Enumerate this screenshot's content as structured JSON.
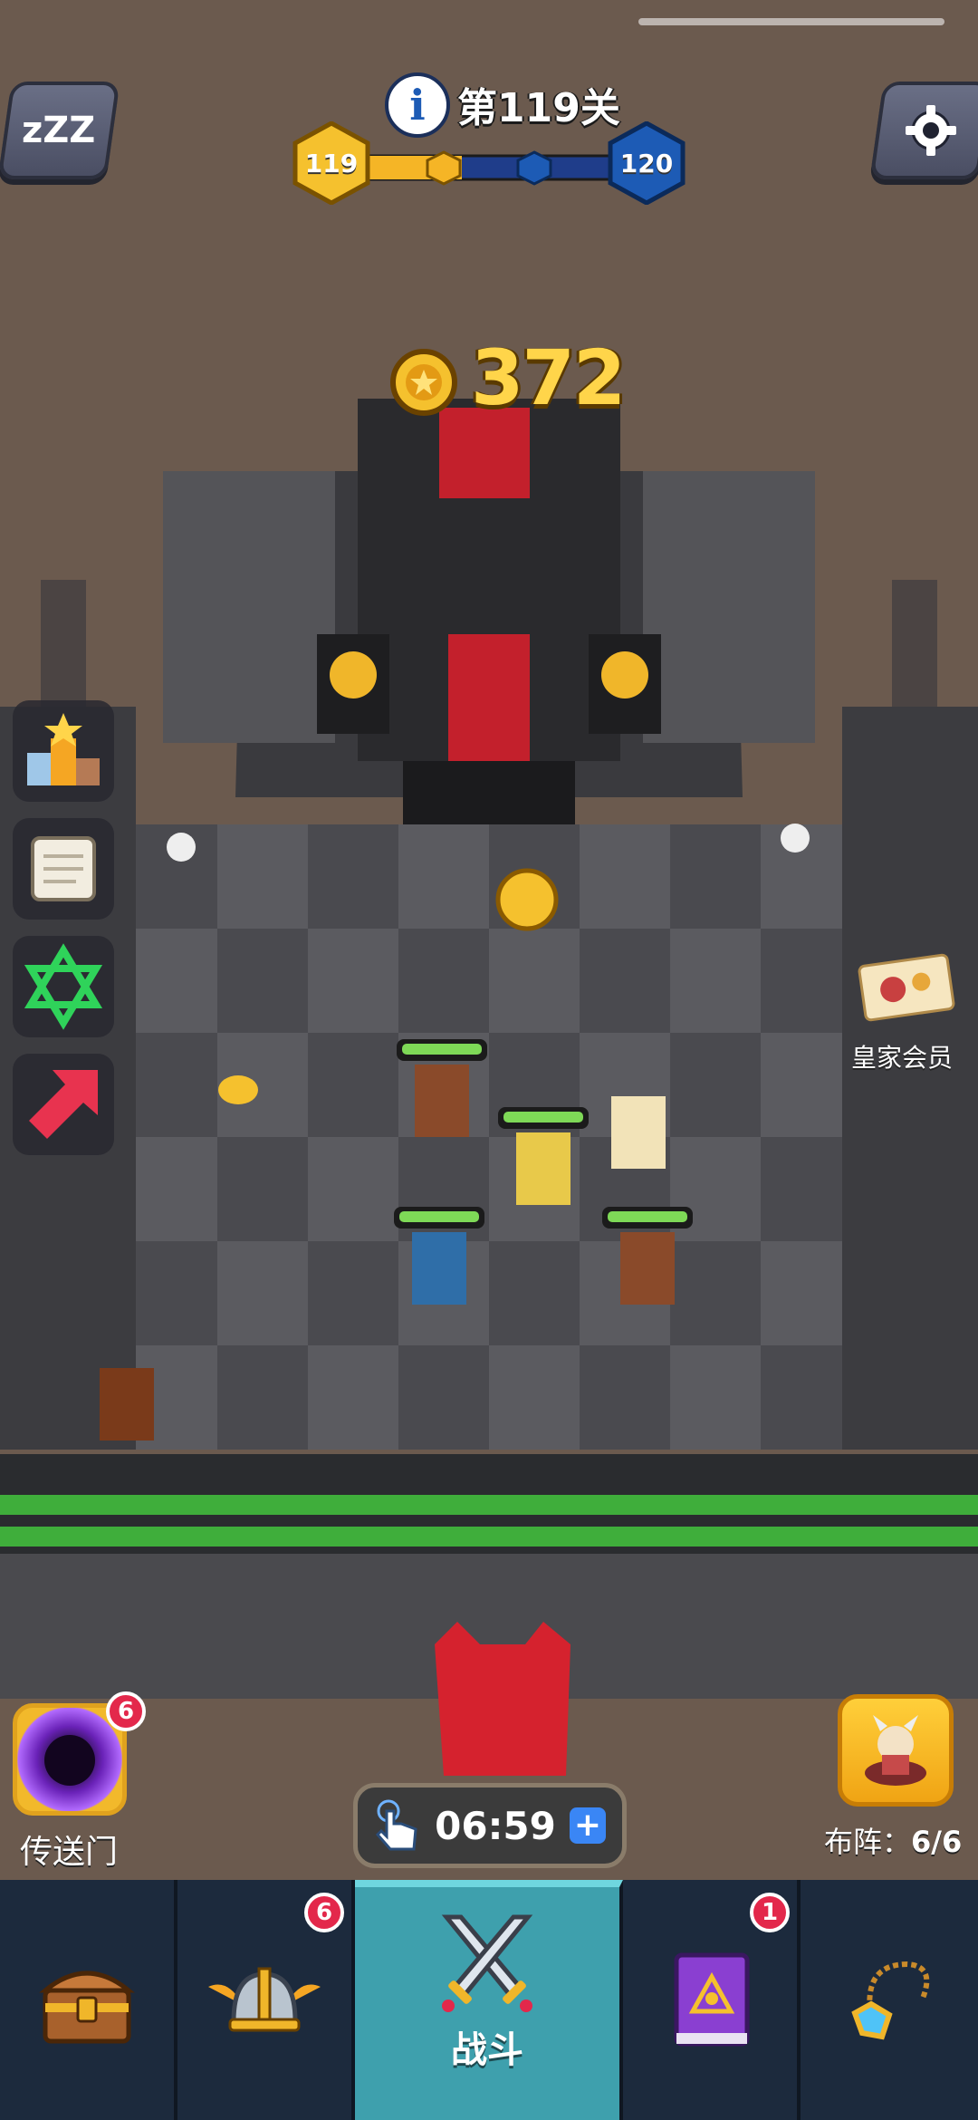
{
  "hud": {
    "level_title": "第119关",
    "current_level": "119",
    "next_level": "120",
    "coins": "372"
  },
  "side_buttons": [
    {
      "name": "ranking",
      "icon": "podium-star-icon"
    },
    {
      "name": "scroll",
      "icon": "scroll-icon"
    },
    {
      "name": "hexagram",
      "icon": "hexagram-icon"
    },
    {
      "name": "arrow",
      "icon": "red-arrow-icon"
    }
  ],
  "royal_member": {
    "label": "皇家会员"
  },
  "portal": {
    "label": "传送门",
    "badge": "6"
  },
  "formation": {
    "label": "布阵：",
    "count": "6/6"
  },
  "timer": {
    "value": "06:59"
  },
  "nav": {
    "tabs": [
      {
        "icon": "treasure-chest-icon"
      },
      {
        "icon": "winged-helmet-icon",
        "badge": "6"
      },
      {
        "icon": "crossed-swords-icon",
        "label": "战斗",
        "active": true
      },
      {
        "icon": "spellbook-icon",
        "badge": "1"
      },
      {
        "icon": "amulet-icon"
      }
    ]
  },
  "colors": {
    "gold": "#ffd54a",
    "nav_bg": "#1c2a3d",
    "nav_active": "#3ea0ad",
    "badge": "#e3284b",
    "health": "#7ed957"
  }
}
